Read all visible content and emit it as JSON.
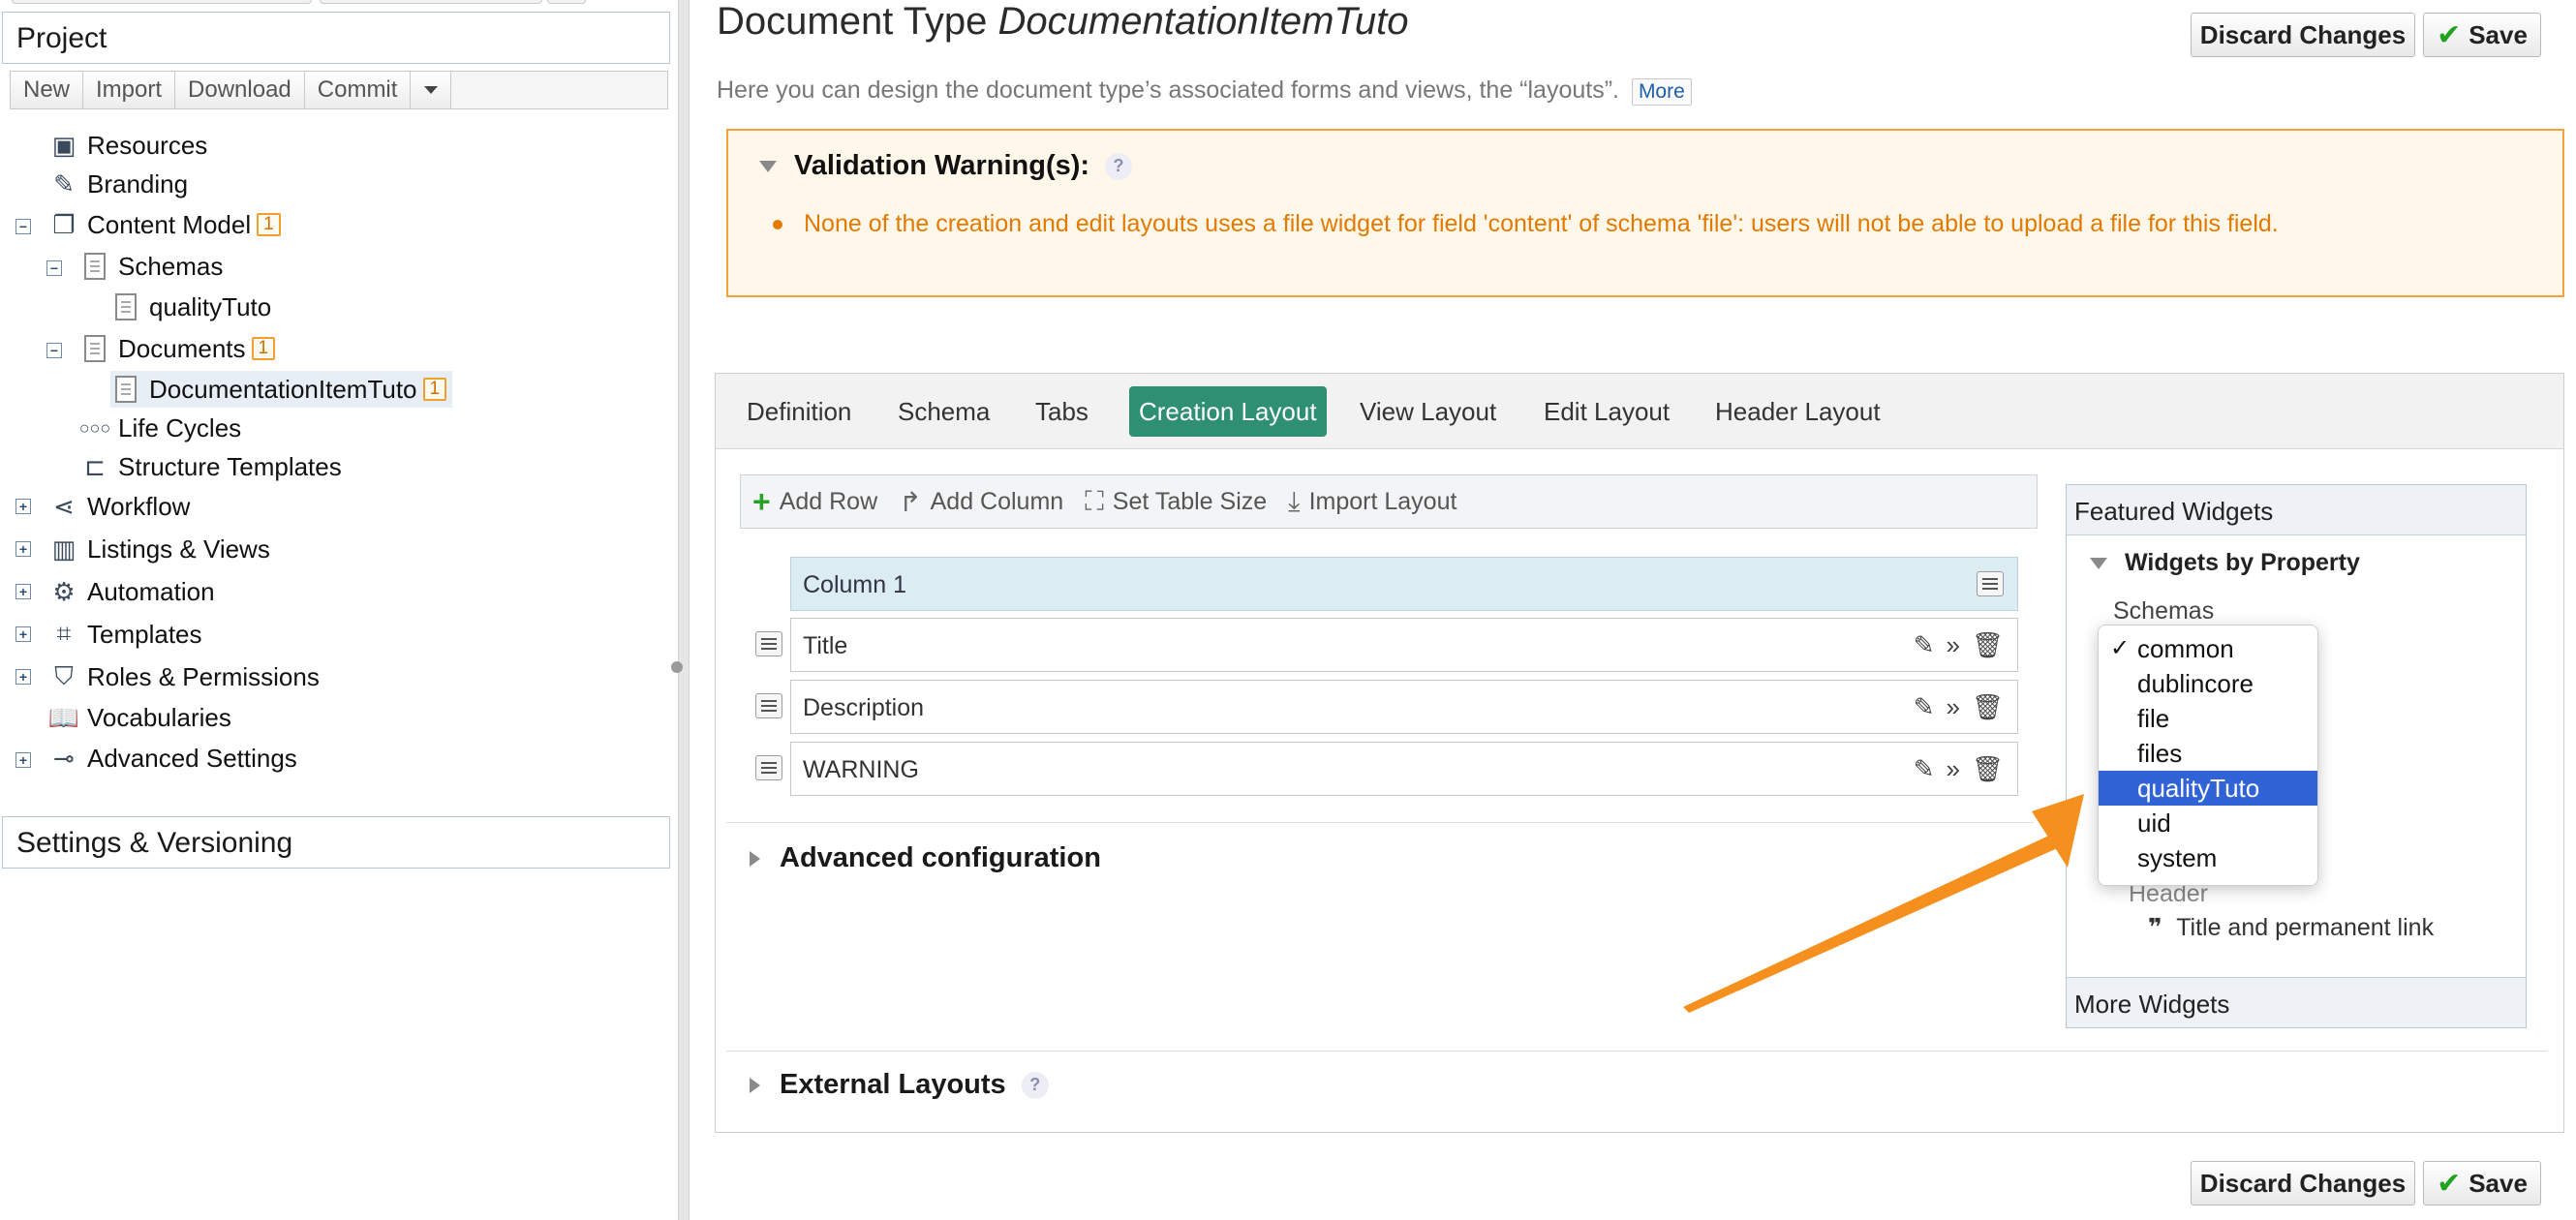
{
  "left": {
    "project_header": "Project",
    "toolbar": [
      "New",
      "Import",
      "Download",
      "Commit"
    ],
    "tree": [
      {
        "label": "Resources",
        "icon": "resources-icon",
        "badge": ""
      },
      {
        "label": "Branding",
        "icon": "branding-icon",
        "badge": ""
      },
      {
        "label": "Content Model",
        "icon": "content-model-icon",
        "badge": "1"
      },
      {
        "label": "Schemas",
        "icon": "schemas-icon",
        "badge": ""
      },
      {
        "label": "qualityTuto",
        "icon": "document-icon",
        "badge": ""
      },
      {
        "label": "Documents",
        "icon": "documents-icon",
        "badge": "1"
      },
      {
        "label": "DocumentationItemTuto",
        "icon": "document-icon",
        "badge": "1"
      },
      {
        "label": "Life Cycles",
        "icon": "life-cycles-icon",
        "badge": ""
      },
      {
        "label": "Structure Templates",
        "icon": "structure-templates-icon",
        "badge": ""
      },
      {
        "label": "Workflow",
        "icon": "workflow-icon",
        "badge": ""
      },
      {
        "label": "Listings & Views",
        "icon": "listings-icon",
        "badge": ""
      },
      {
        "label": "Automation",
        "icon": "automation-icon",
        "badge": ""
      },
      {
        "label": "Templates",
        "icon": "templates-icon",
        "badge": ""
      },
      {
        "label": "Roles & Permissions",
        "icon": "roles-icon",
        "badge": ""
      },
      {
        "label": "Vocabularies",
        "icon": "vocabularies-icon",
        "badge": ""
      },
      {
        "label": "Advanced Settings",
        "icon": "advanced-settings-icon",
        "badge": ""
      }
    ],
    "settings_header": "Settings & Versioning"
  },
  "header": {
    "title_prefix": "Document Type",
    "title_name": "DocumentationItemTuto",
    "subtitle": "Here you can design the document type’s associated forms and views, the “layouts”.",
    "more_link": "More",
    "discard_label": "Discard Changes",
    "save_label": "Save"
  },
  "validation": {
    "title": "Validation Warning(s):",
    "help": "?",
    "message": "None of the creation and edit layouts uses a file widget for field 'content' of schema 'file': users will not be able to upload a file for this field."
  },
  "tabs": [
    "Definition",
    "Schema",
    "Tabs",
    "Creation Layout",
    "View Layout",
    "Edit Layout",
    "Header Layout"
  ],
  "active_tab": "Creation Layout",
  "layout_toolbar": {
    "add_row": "Add Row",
    "add_column": "Add Column",
    "set_table_size": "Set Table Size",
    "import_layout": "Import Layout"
  },
  "grid": {
    "column_header": "Column 1",
    "rows": [
      "Title",
      "Description",
      "WARNING"
    ]
  },
  "advanced_config": "Advanced configuration",
  "external_layouts": "External Layouts",
  "widgets": {
    "featured_header": "Featured Widgets",
    "by_property": "Widgets by Property",
    "schemas_label": "Schemas",
    "dropdown_options": [
      "common",
      "dublincore",
      "file",
      "files",
      "qualityTuto",
      "uid",
      "system"
    ],
    "checked_option": "common",
    "highlighted_option": "qualityTuto",
    "template_widget": "Title and permanent link",
    "more_widgets": "More Widgets",
    "ghost_header": "Header"
  },
  "colors": {
    "accent_green": "#2f8f72",
    "warning_orange": "#e27a00",
    "arrow_orange": "#f5901e",
    "dropdown_highlight": "#2f63d6"
  }
}
